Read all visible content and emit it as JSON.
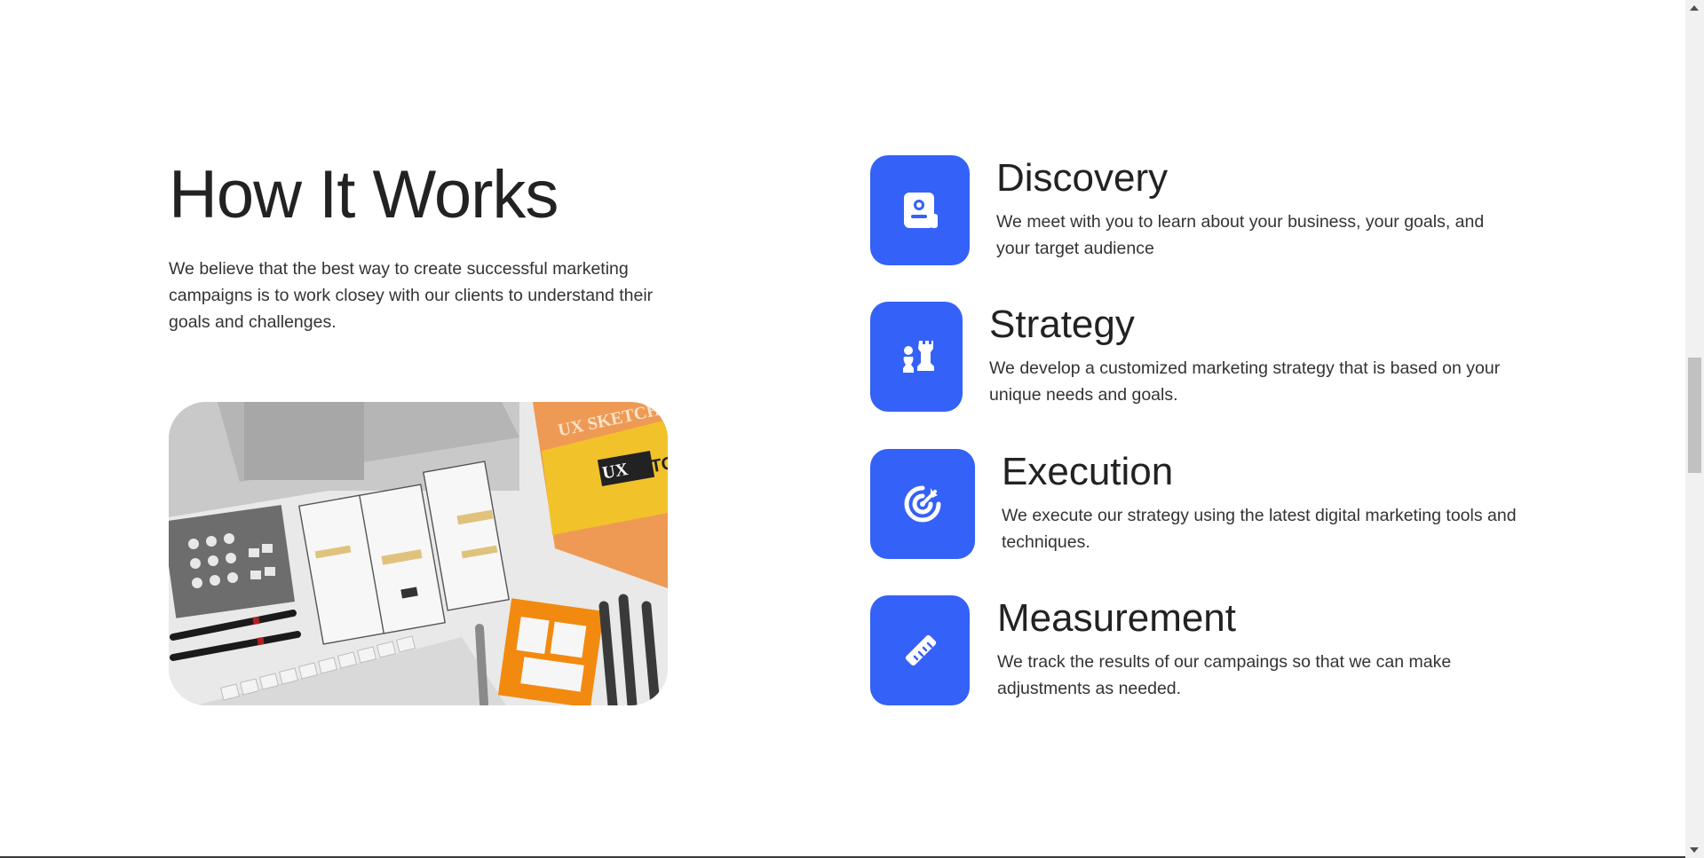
{
  "section": {
    "title": "How It Works",
    "intro": "We believe that the best way to create successful marketing campaigns is to work closey with our clients to understand their goals and challenges."
  },
  "hero_image": {
    "alt": "",
    "icon": "image-collage"
  },
  "steps": [
    {
      "title": "Discovery",
      "description": "We meet with you to learn about your business, your goals, and your target audience",
      "icon": "contact-card-icon"
    },
    {
      "title": "Strategy",
      "description": "We develop a customized marketing strategy that is based on your unique needs and goals.",
      "icon": "chess-pieces-icon"
    },
    {
      "title": "Execution",
      "description": "We execute our strategy using the latest digital marketing tools and techniques.",
      "icon": "target-icon"
    },
    {
      "title": "Measurement",
      "description": "We track the results of our campaings so that we can make adjustments as needed.",
      "icon": "ruler-icon"
    }
  ],
  "colors": {
    "accent": "#3461f7",
    "text": "#222222",
    "background": "#ffffff"
  }
}
